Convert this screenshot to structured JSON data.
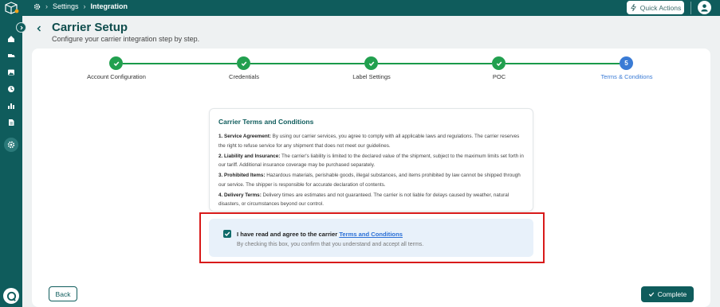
{
  "breadcrumb": {
    "settings": "Settings",
    "current": "Integration"
  },
  "header": {
    "quick_actions": "Quick Actions",
    "title": "Carrier Setup",
    "subtitle": "Configure your carrier integration step by step."
  },
  "steps": [
    {
      "label": "Account Configuration",
      "status": "done"
    },
    {
      "label": "Credentials",
      "status": "done"
    },
    {
      "label": "Label Settings",
      "status": "done"
    },
    {
      "label": "POC",
      "status": "done"
    },
    {
      "label": "Terms & Conditions",
      "status": "current",
      "number": "5"
    }
  ],
  "terms": {
    "heading": "Carrier Terms and Conditions",
    "clauses": [
      {
        "title": "1. Service Agreement:",
        "text": "By using our carrier services, you agree to comply with all applicable laws and regulations. The carrier reserves the right to refuse service for any shipment that does not meet our guidelines."
      },
      {
        "title": "2. Liability and Insurance:",
        "text": "The carrier's liability is limited to the declared value of the shipment, subject to the maximum limits set forth in our tariff. Additional insurance coverage may be purchased separately."
      },
      {
        "title": "3. Prohibited Items:",
        "text": "Hazardous materials, perishable goods, illegal substances, and items prohibited by law cannot be shipped through our service. The shipper is responsible for accurate declaration of contents."
      },
      {
        "title": "4. Delivery Terms:",
        "text": "Delivery times are estimates and not guaranteed. The carrier is not liable for delays caused by weather, natural disasters, or circumstances beyond our control."
      }
    ]
  },
  "agreement": {
    "label": "I have read and agree to the carrier",
    "link": "Terms and Conditions",
    "note": "By checking this box, you confirm that you understand and accept all terms.",
    "checked": true
  },
  "footer": {
    "back": "Back",
    "complete": "Complete"
  },
  "colors": {
    "brand": "#0f5c5c",
    "success": "#22a04f",
    "current_step": "#3a7bd5",
    "highlight": "#d81a1a"
  }
}
